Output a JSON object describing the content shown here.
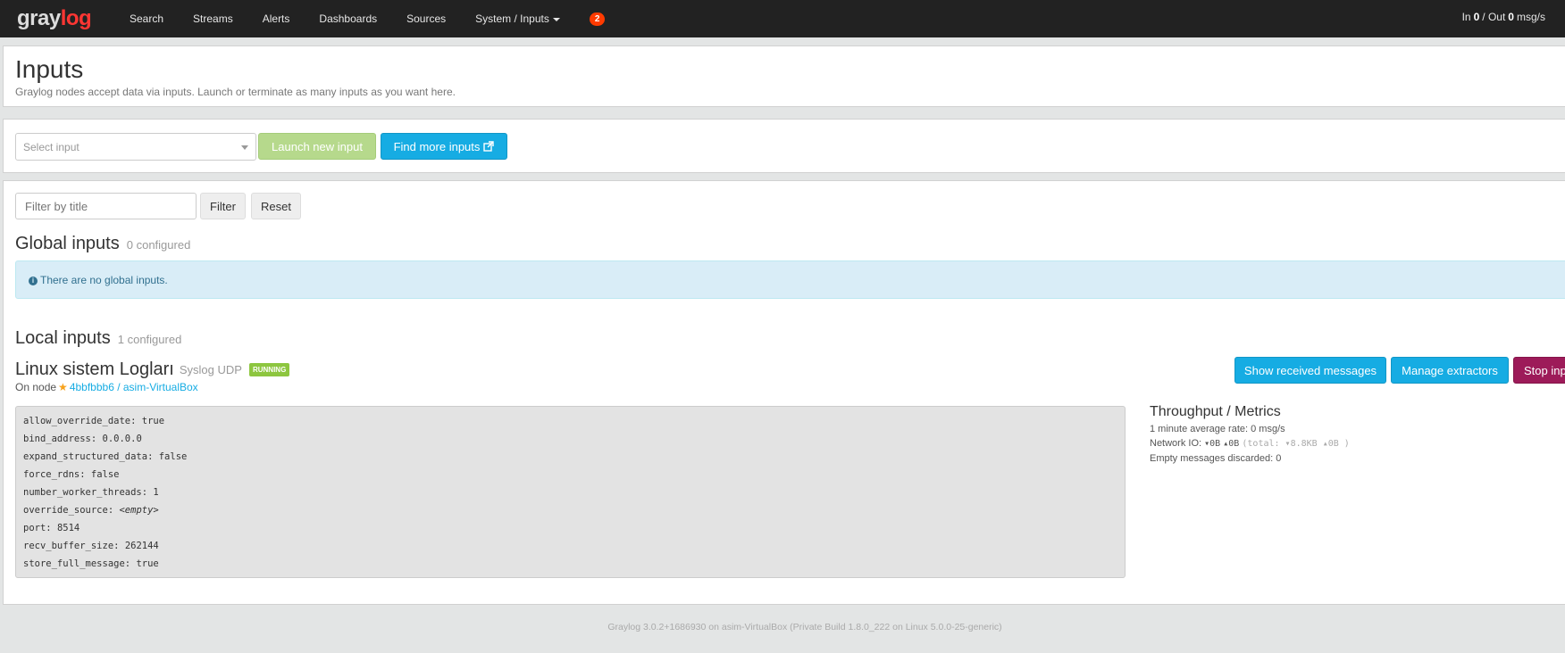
{
  "navbar": {
    "logo_part1": "gray",
    "logo_part2": "log",
    "links": [
      "Search",
      "Streams",
      "Alerts",
      "Dashboards",
      "Sources",
      "System / Inputs"
    ],
    "notification_count": "2",
    "throughput": {
      "in_label": "In",
      "in_value": "0",
      "separator": "/ Out",
      "out_value": "0",
      "unit": "msg/s"
    }
  },
  "header": {
    "title": "Inputs",
    "description": "Graylog nodes accept data via inputs. Launch or terminate as many inputs as you want here."
  },
  "launch": {
    "select_placeholder": "Select input",
    "launch_label": "Launch new input",
    "find_label": "Find more inputs"
  },
  "filter": {
    "placeholder": "Filter by title",
    "filter_label": "Filter",
    "reset_label": "Reset"
  },
  "global_inputs": {
    "title": "Global inputs",
    "count": "0 configured",
    "empty_message": "There are no global inputs."
  },
  "local_inputs": {
    "title": "Local inputs",
    "count": "1 configured",
    "input": {
      "name": "Linux sistem Logları",
      "type": "Syslog UDP",
      "status": "RUNNING",
      "on_node_label": "On node",
      "node": "4bbfbbb6 / asim-VirtualBox",
      "buttons": {
        "show": "Show received messages",
        "manage": "Manage extractors",
        "stop": "Stop input"
      },
      "config": [
        {
          "key": "allow_override_date",
          "value": "true"
        },
        {
          "key": "bind_address",
          "value": "0.0.0.0"
        },
        {
          "key": "expand_structured_data",
          "value": "false"
        },
        {
          "key": "force_rdns",
          "value": "false"
        },
        {
          "key": "number_worker_threads",
          "value": "1"
        },
        {
          "key": "override_source",
          "value": "<empty>"
        },
        {
          "key": "port",
          "value": "8514"
        },
        {
          "key": "recv_buffer_size",
          "value": "262144"
        },
        {
          "key": "store_full_message",
          "value": "true"
        }
      ],
      "metrics": {
        "title": "Throughput / Metrics",
        "avg_rate": "1 minute average rate: 0 msg/s",
        "network_label": "Network IO:",
        "network_in": "▾0B",
        "network_out": "▴0B",
        "network_total": "(total: ▾8.8KB ▴0B )",
        "discarded": "Empty messages discarded: 0"
      }
    }
  },
  "footer": {
    "text": "Graylog 3.0.2+1686930 on asim-VirtualBox (Private Build 1.8.0_222 on Linux 5.0.0-25-generic)"
  }
}
